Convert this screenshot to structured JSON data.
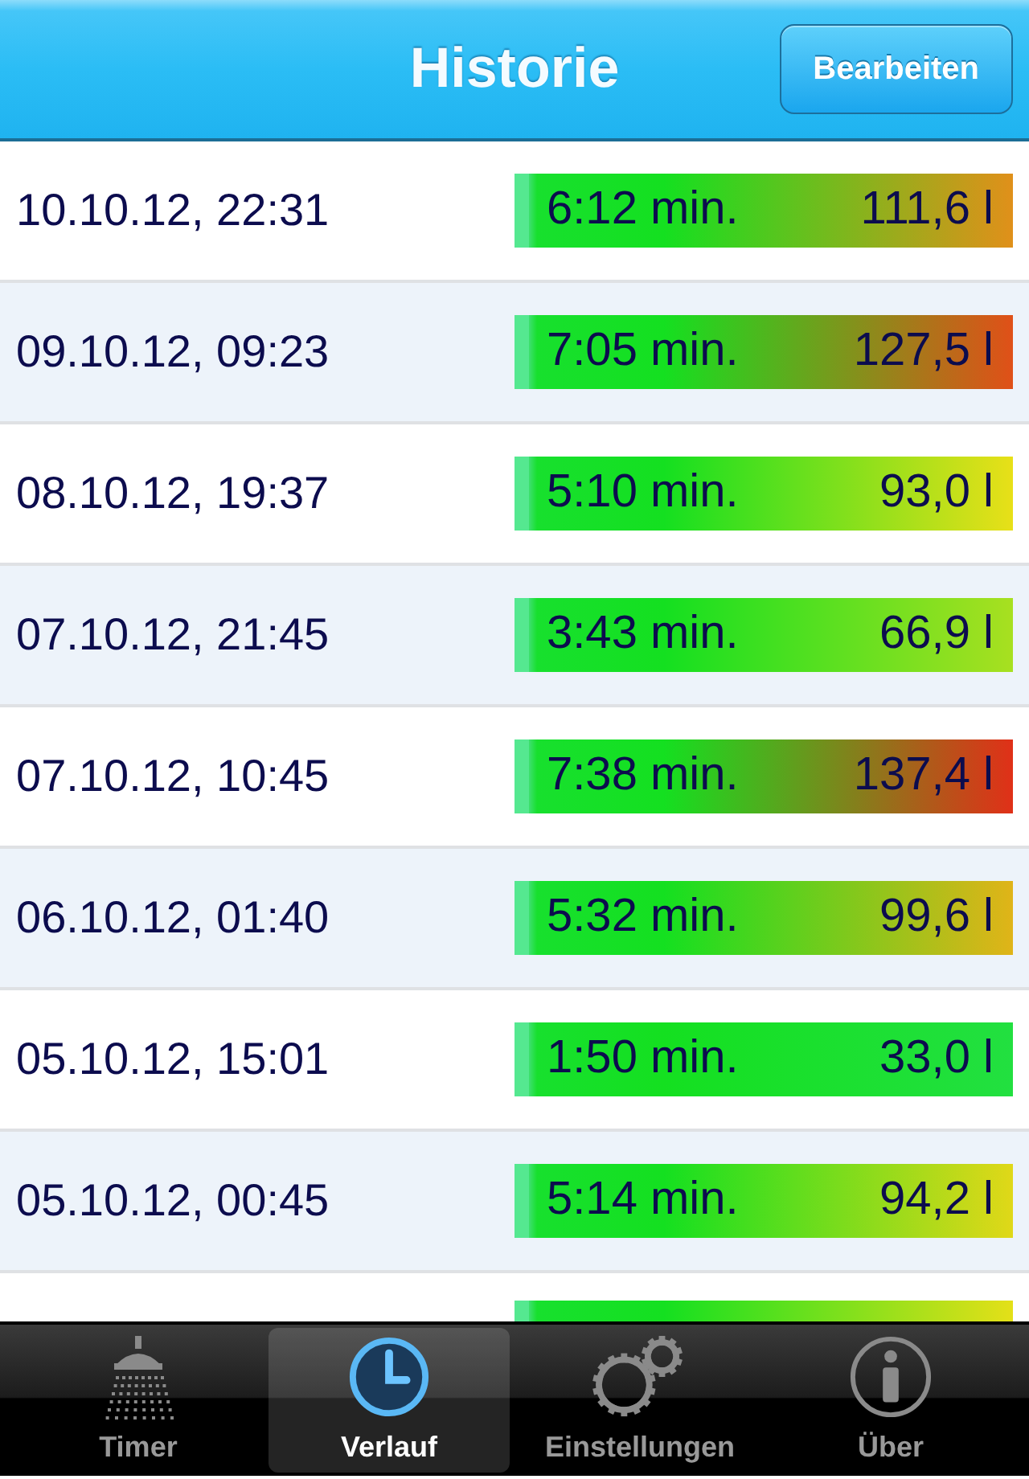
{
  "nav_bar": {
    "title": "Historie",
    "button": "Bearbeiten"
  },
  "rows": [
    {
      "date": "10.10.12, 22:31",
      "duration": "6:12 min.",
      "volume": "111,6 l",
      "color": "#e0901a"
    },
    {
      "date": "09.10.12, 09:23",
      "duration": "7:05 min.",
      "volume": "127,5 l",
      "color": "#e05018"
    },
    {
      "date": "08.10.12, 19:37",
      "duration": "5:10 min.",
      "volume": "93,0 l",
      "color": "#e8e018"
    },
    {
      "date": "07.10.12, 21:45",
      "duration": "3:43 min.",
      "volume": "66,9 l",
      "color": "#a8e020"
    },
    {
      "date": "07.10.12, 10:45",
      "duration": "7:38 min.",
      "volume": "137,4 l",
      "color": "#e03018"
    },
    {
      "date": "06.10.12, 01:40",
      "duration": "5:32 min.",
      "volume": "99,6 l",
      "color": "#e0b418"
    },
    {
      "date": "05.10.12, 15:01",
      "duration": "1:50 min.",
      "volume": "33,0 l",
      "color": "#22e040"
    },
    {
      "date": "05.10.12, 00:45",
      "duration": "5:14 min.",
      "volume": "94,2 l",
      "color": "#e0d818"
    },
    {
      "color": "#e4e018"
    }
  ],
  "tab_bar": [
    {
      "kind": "shower",
      "label": "Timer",
      "selected": false
    },
    {
      "kind": "clock",
      "label": "Verlauf",
      "selected": true
    },
    {
      "kind": "gears",
      "label": "Einstellungen",
      "selected": false
    },
    {
      "kind": "info",
      "label": "Über",
      "selected": false
    }
  ]
}
